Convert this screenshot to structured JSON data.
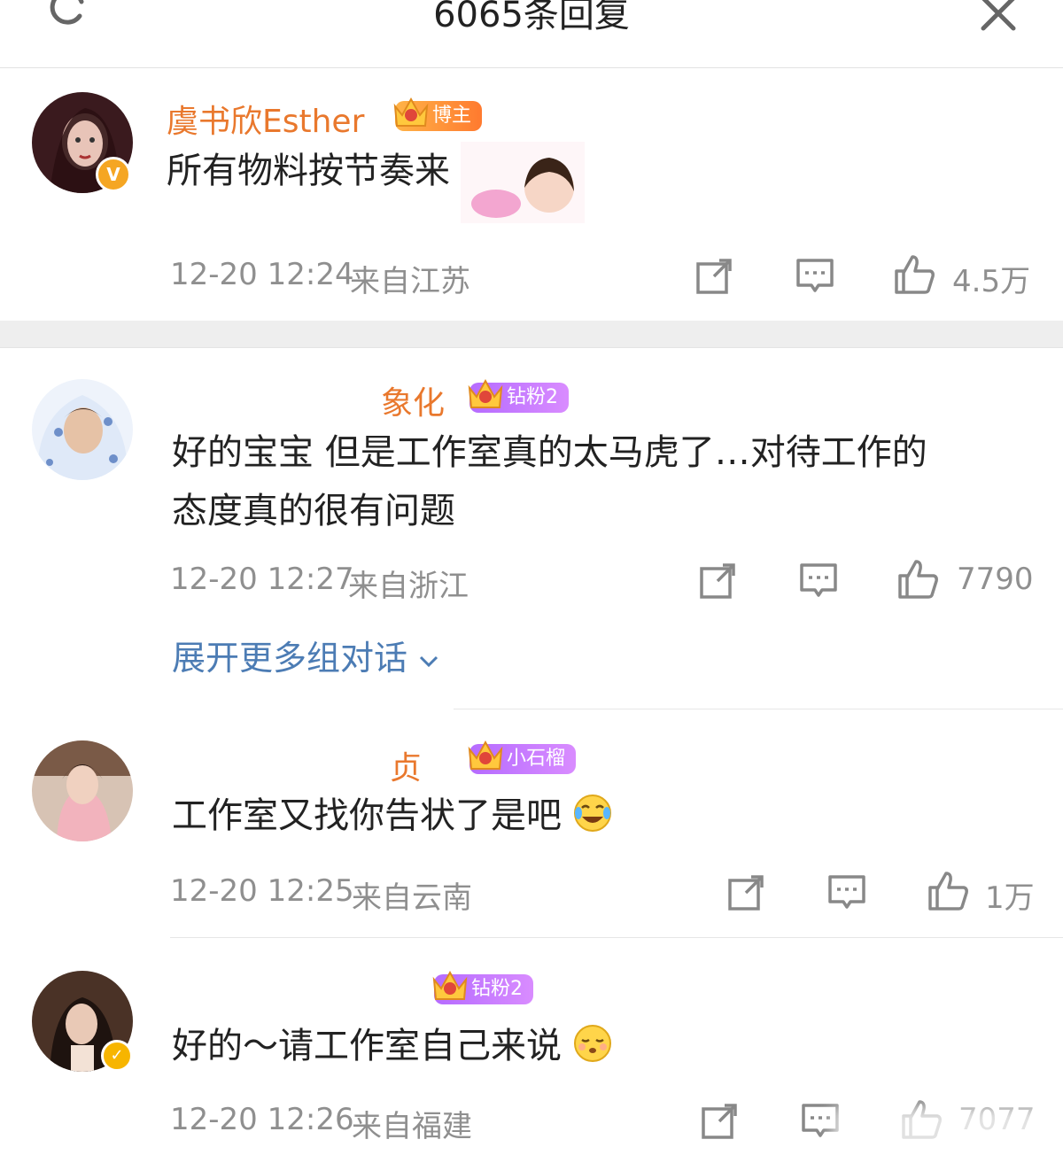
{
  "header": {
    "title": "6065条回复"
  },
  "comments": [
    {
      "username": "虞书欣Esther",
      "badge": "博主",
      "badge_level": "8",
      "text": "所有物料按节奏来",
      "time": "12-20 12:24",
      "location": "来自江苏",
      "likes": "4.5万"
    },
    {
      "username": "象化",
      "badge": "钻粉2",
      "badge_level": "6",
      "text_line1": "好的宝宝 但是工作室真的太马虎了…对待工作的",
      "text_line2": "态度真的很有问题",
      "time": "12-20 12:27",
      "location": "来自浙江",
      "likes": "7790"
    },
    {
      "username": "贞",
      "badge": "小石榴",
      "badge_level": "7",
      "text": "工作室又找你告状了是吧",
      "time": "12-20 12:25",
      "location": "来自云南",
      "likes": "1万"
    },
    {
      "username": "",
      "badge": "钻粉2",
      "badge_level": "6",
      "text": "好的～请工作室自己来说",
      "time": "12-20 12:26",
      "location": "来自福建",
      "likes": "7077"
    }
  ],
  "expand_label": "展开更多组对话",
  "colors": {
    "username": "#e9782d",
    "link": "#4c7cb4",
    "meta": "#8f8f8f"
  }
}
